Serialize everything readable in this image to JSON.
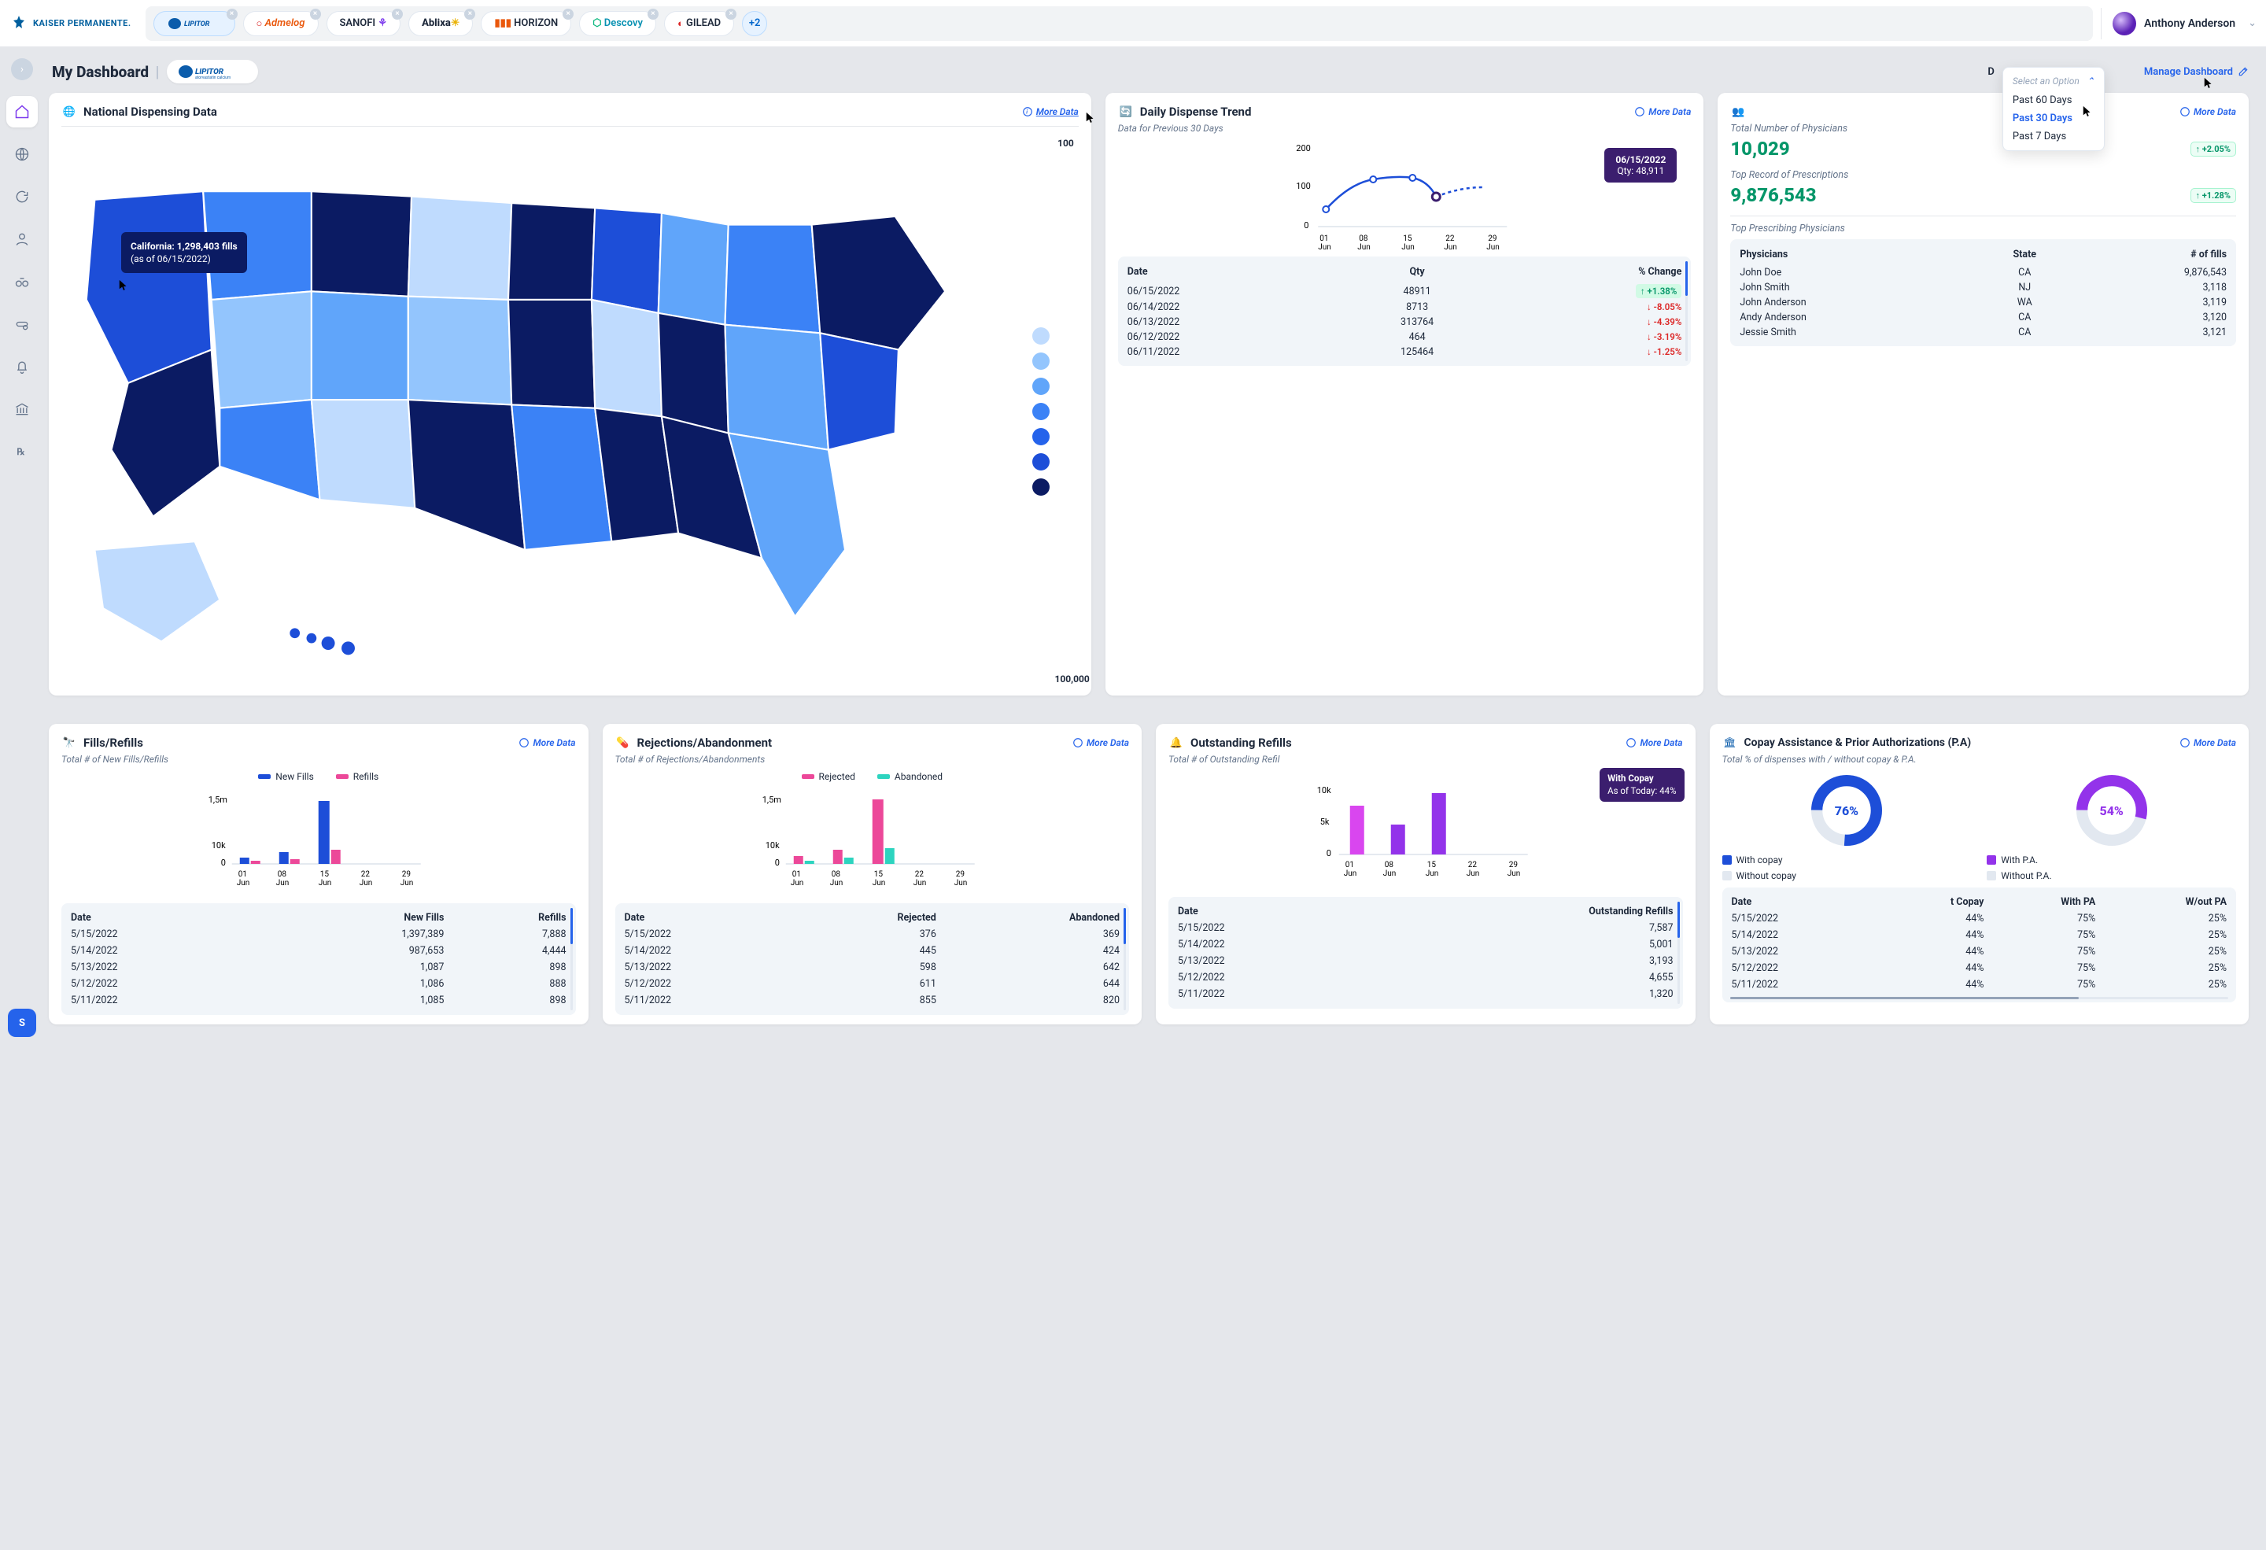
{
  "topbar": {
    "org": "KAISER PERMANENTE.",
    "chips": [
      "LIPITOR",
      "Admelog",
      "SANOFI",
      "Ablixa",
      "HORIZON",
      "Descovy",
      "GILEAD"
    ],
    "chip_more": "+2",
    "user": "Anthony Anderson"
  },
  "title": {
    "heading": "My Dashboard",
    "dd_label": "D",
    "dropdown": {
      "head": "Select an Option",
      "items": [
        "Past 60 Days",
        "Past 30 Days",
        "Past 7 Days"
      ],
      "selected": "Past 30 Days"
    },
    "manage": "Manage Dashboard"
  },
  "cards": {
    "map": {
      "title": "National Dispensing Data",
      "more": "More Data",
      "tooltip_line1": "California: 1,298,403 fills",
      "tooltip_line2": "(as of 06/15/2022)",
      "legend_top": "100",
      "legend_bottom": "100,000",
      "legend_colors": [
        "#bfdbfe",
        "#93c5fd",
        "#60a5fa",
        "#3b82f6",
        "#2563eb",
        "#1d4ed8",
        "#0b1b63"
      ]
    },
    "trend": {
      "title": "Daily Dispense Trend",
      "more": "More Data",
      "subtitle": "Data for Previous 30 Days",
      "y_ticks": [
        "200",
        "100",
        "0"
      ],
      "x_ticks": [
        "01 Jun",
        "08 Jun",
        "15 Jun",
        "22 Jun",
        "29 Jun"
      ],
      "tooltip_date": "06/15/2022",
      "tooltip_qty": "Qty: 48,911",
      "table_headers": [
        "Date",
        "Qty",
        "% Change"
      ],
      "rows": [
        {
          "date": "06/15/2022",
          "qty": "48911",
          "pct": "+1.38%",
          "dir": "up",
          "box": true
        },
        {
          "date": "06/14/2022",
          "qty": "8713",
          "pct": "-8.05%",
          "dir": "down"
        },
        {
          "date": "06/13/2022",
          "qty": "313764",
          "pct": "-4.39%",
          "dir": "down"
        },
        {
          "date": "06/12/2022",
          "qty": "464",
          "pct": "-3.19%",
          "dir": "down"
        },
        {
          "date": "06/11/2022",
          "qty": "125464",
          "pct": "-1.25%",
          "dir": "down"
        }
      ]
    },
    "phys": {
      "more": "More Data",
      "metric1_label": "Total Number of Physicians",
      "metric1_value": "10,029",
      "metric1_delta": "+2.05%",
      "metric2_label": "Top Record of Prescriptions",
      "metric2_value": "9,876,543",
      "metric2_delta": "+1.28%",
      "section_label": "Top Prescribing Physicians",
      "headers": [
        "Physicians",
        "State",
        "# of fills"
      ],
      "rows": [
        {
          "n": "John Doe",
          "s": "CA",
          "f": "9,876,543"
        },
        {
          "n": "John Smith",
          "s": "NJ",
          "f": "3,118"
        },
        {
          "n": "John Anderson",
          "s": "WA",
          "f": "3,119"
        },
        {
          "n": "Andy Anderson",
          "s": "CA",
          "f": "3,120"
        },
        {
          "n": "Jessie Smith",
          "s": "CA",
          "f": "3,121"
        }
      ]
    },
    "fills": {
      "title": "Fills/Refills",
      "more": "More Data",
      "subtitle": "Total # of New Fills/Refills",
      "legend": [
        "New Fills",
        "Refills"
      ],
      "y_ticks": [
        "1,5m",
        "10k",
        "0"
      ],
      "x_ticks": [
        "01 Jun",
        "08 Jun",
        "15 Jun",
        "22 Jun",
        "29 Jun"
      ],
      "headers": [
        "Date",
        "New Fills",
        "Refills"
      ],
      "rows": [
        {
          "d": "5/15/2022",
          "a": "1,397,389",
          "b": "7,888"
        },
        {
          "d": "5/14/2022",
          "a": "987,653",
          "b": "4,444"
        },
        {
          "d": "5/13/2022",
          "a": "1,087",
          "b": "898"
        },
        {
          "d": "5/12/2022",
          "a": "1,086",
          "b": "888"
        },
        {
          "d": "5/11/2022",
          "a": "1,085",
          "b": "898"
        }
      ]
    },
    "reject": {
      "title": "Rejections/Abandonment",
      "more": "More Data",
      "subtitle": "Total # of Rejections/Abandonments",
      "legend": [
        "Rejected",
        "Abandoned"
      ],
      "y_ticks": [
        "1,5m",
        "10k",
        "0"
      ],
      "x_ticks": [
        "01 Jun",
        "08 Jun",
        "15 Jun",
        "22 Jun",
        "29 Jun"
      ],
      "headers": [
        "Date",
        "Rejected",
        "Abandoned"
      ],
      "rows": [
        {
          "d": "5/15/2022",
          "a": "376",
          "b": "369"
        },
        {
          "d": "5/14/2022",
          "a": "445",
          "b": "424"
        },
        {
          "d": "5/13/2022",
          "a": "598",
          "b": "642"
        },
        {
          "d": "5/12/2022",
          "a": "611",
          "b": "644"
        },
        {
          "d": "5/11/2022",
          "a": "855",
          "b": "820"
        }
      ]
    },
    "outstanding": {
      "title": "Outstanding Refills",
      "more": "More Data",
      "subtitle": "Total # of Outstanding Refil",
      "tooltip_l1": "With Copay",
      "tooltip_l2": "As of Today: 44%",
      "y_ticks": [
        "10k",
        "5k",
        "0"
      ],
      "x_ticks": [
        "01 Jun",
        "08 Jun",
        "15 Jun",
        "22 Jun",
        "29 Jun"
      ],
      "headers": [
        "Date",
        "Outstanding Refills"
      ],
      "rows": [
        {
          "d": "5/15/2022",
          "a": "7,587"
        },
        {
          "d": "5/14/2022",
          "a": "5,001"
        },
        {
          "d": "5/13/2022",
          "a": "3,193"
        },
        {
          "d": "5/12/2022",
          "a": "4,655"
        },
        {
          "d": "5/11/2022",
          "a": "1,320"
        }
      ]
    },
    "copay": {
      "title": "Copay Assistance & Prior Authorizations (P.A)",
      "more": "More Data",
      "subtitle": "Total % of dispenses with / without copay & P.A.",
      "donut1": "76%",
      "donut2": "54%",
      "legend": [
        "With copay",
        "With P.A.",
        "Without copay",
        "Without P.A."
      ],
      "headers": [
        "Date",
        "t Copay",
        "With PA",
        "W/out PA"
      ],
      "rows": [
        {
          "d": "5/15/2022",
          "a": "44%",
          "b": "75%",
          "c": "25%"
        },
        {
          "d": "5/14/2022",
          "a": "44%",
          "b": "75%",
          "c": "25%"
        },
        {
          "d": "5/13/2022",
          "a": "44%",
          "b": "75%",
          "c": "25%"
        },
        {
          "d": "5/12/2022",
          "a": "44%",
          "b": "75%",
          "c": "25%"
        },
        {
          "d": "5/11/2022",
          "a": "44%",
          "b": "75%",
          "c": "25%"
        }
      ]
    }
  },
  "chart_data": [
    {
      "type": "line",
      "name": "Daily Dispense Trend",
      "x": [
        "01 Jun",
        "08 Jun",
        "15 Jun",
        "22 Jun",
        "29 Jun"
      ],
      "values": [
        60,
        115,
        120,
        90,
        100
      ],
      "ylim": [
        0,
        200
      ],
      "ylabel": "",
      "title": "Daily Dispense Trend"
    },
    {
      "type": "bar",
      "name": "Fills/Refills",
      "categories": [
        "01 Jun",
        "08 Jun",
        "15 Jun",
        "22 Jun",
        "29 Jun"
      ],
      "series": [
        {
          "name": "New Fills",
          "values": [
            50000,
            120000,
            1400000,
            0,
            0
          ]
        },
        {
          "name": "Refills",
          "values": [
            20000,
            30000,
            180000,
            0,
            0
          ]
        }
      ],
      "ylim": [
        0,
        1500000
      ]
    },
    {
      "type": "bar",
      "name": "Rejections/Abandonment",
      "categories": [
        "01 Jun",
        "08 Jun",
        "15 Jun",
        "22 Jun",
        "29 Jun"
      ],
      "series": [
        {
          "name": "Rejected",
          "values": [
            60000,
            140000,
            1400000,
            0,
            0
          ]
        },
        {
          "name": "Abandoned",
          "values": [
            20000,
            70000,
            200000,
            0,
            0
          ]
        }
      ],
      "ylim": [
        0,
        1500000
      ]
    },
    {
      "type": "bar",
      "name": "Outstanding Refills",
      "categories": [
        "01 Jun",
        "08 Jun",
        "15 Jun",
        "22 Jun",
        "29 Jun"
      ],
      "series": [
        {
          "name": "Outstanding",
          "values": [
            5800,
            3400,
            7600,
            0,
            0
          ]
        }
      ],
      "ylim": [
        0,
        10000
      ]
    },
    {
      "type": "pie",
      "name": "Copay",
      "series": [
        {
          "name": "With copay",
          "value": 76
        },
        {
          "name": "Without copay",
          "value": 24
        }
      ]
    },
    {
      "type": "pie",
      "name": "PA",
      "series": [
        {
          "name": "With P.A.",
          "value": 54
        },
        {
          "name": "Without P.A.",
          "value": 46
        }
      ]
    }
  ]
}
